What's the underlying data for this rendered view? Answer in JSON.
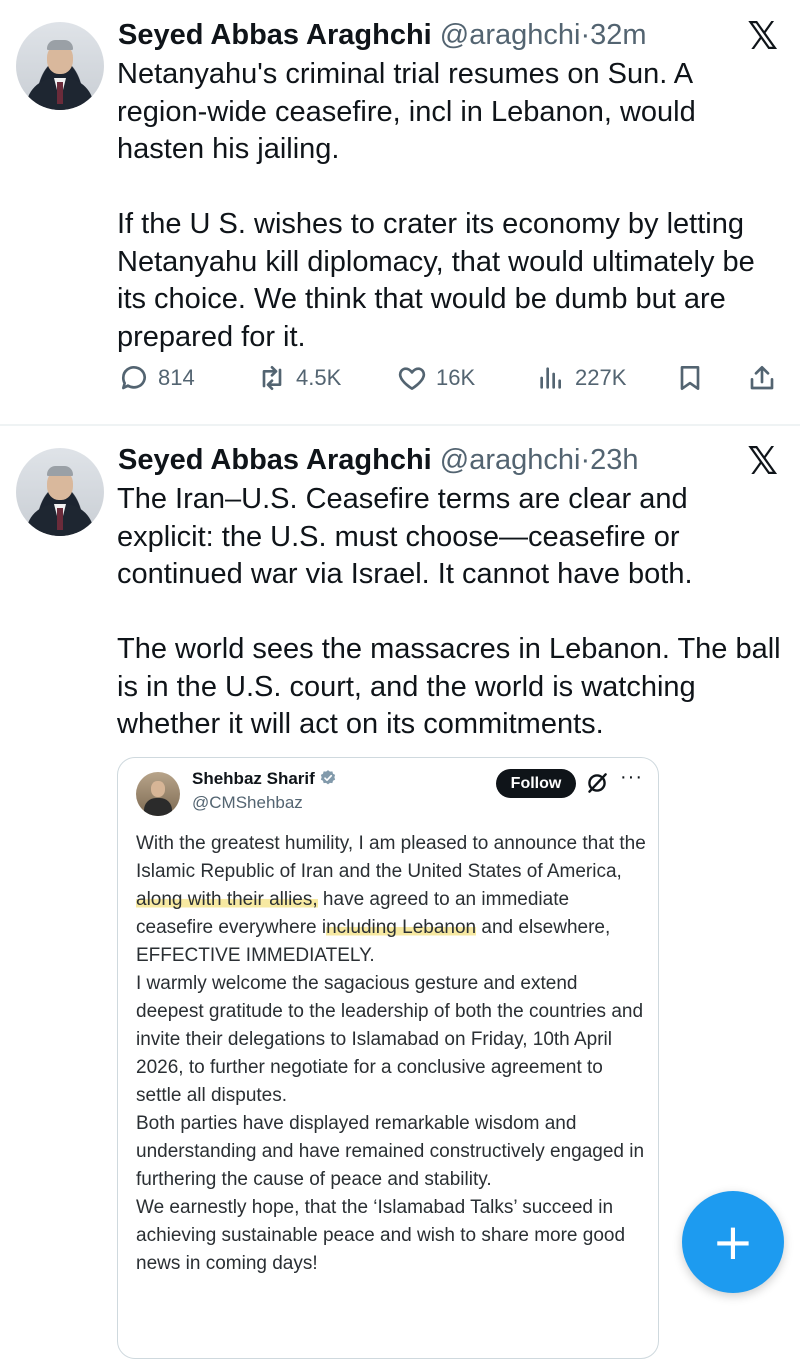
{
  "tweets": [
    {
      "author_name": "Seyed Abbas Araghchi",
      "handle": "@araghchi",
      "separator": "·",
      "time": "32m",
      "x_logo": "𝕏",
      "paragraphs": [
        "Netanyahu's criminal trial resumes on Sun. A region-wide ceasefire, incl in Lebanon, would hasten his jailing.",
        "If the U S. wishes to crater its economy by letting Netanyahu kill diplomacy, that would ultimately be its choice. We think that would be dumb but are prepared for it."
      ],
      "actions": {
        "replies": "814",
        "reposts": "4.5K",
        "likes": "16K",
        "views": "227K"
      }
    },
    {
      "author_name": "Seyed Abbas Araghchi",
      "handle": "@araghchi",
      "separator": "·",
      "time": "23h",
      "x_logo": "𝕏",
      "paragraphs": [
        "The Iran–U.S. Ceasefire terms are clear and explicit: the U.S. must choose—ceasefire or continued war via Israel. It cannot have both.",
        "The world sees the massacres in Lebanon. The ball is in the U.S. court, and the world is watching whether it will act on its commitments."
      ],
      "quote": {
        "author_name": "Shehbaz Sharif",
        "handle": "@CMShehbaz",
        "follow_label": "Follow",
        "more_label": "···",
        "p1_a": "With the greatest humility, I am pleased to announce that the Islamic Republic of Iran and the United States of America, ",
        "p1_hl1": "along with their allies,",
        "p1_b": " have agreed to an immediate ceasefire everywhere i",
        "p1_hl2": "ncluding Lebanon",
        "p1_c": " and elsewhere, EFFECTIVE IMMEDIATELY.",
        "p2": "I warmly welcome the sagacious gesture and extend deepest gratitude to the leadership of both the countries and invite their delegations to Islamabad on Friday, 10th April 2026, to further negotiate for a conclusive agreement to settle all disputes.",
        "p3": "Both parties have displayed remarkable wisdom and understanding and have remained constructively engaged in furthering the cause of peace and stability.",
        "p4": "We earnestly hope, that the ‘Islamabad Talks’ succeed in achieving sustainable peace and wish to share more good news in coming days!"
      }
    }
  ],
  "fab_label": "+",
  "colors": {
    "text": "#0f1419",
    "secondary": "#536471",
    "accent": "#1d9bf0",
    "highlight": "#f7e9a2",
    "divider": "#eff3f4"
  },
  "icons": [
    "reply-icon",
    "repost-icon",
    "like-icon",
    "views-icon",
    "bookmark-icon",
    "share-icon",
    "verified-badge-icon",
    "grok-icon",
    "x-logo-icon",
    "compose-plus-icon"
  ]
}
